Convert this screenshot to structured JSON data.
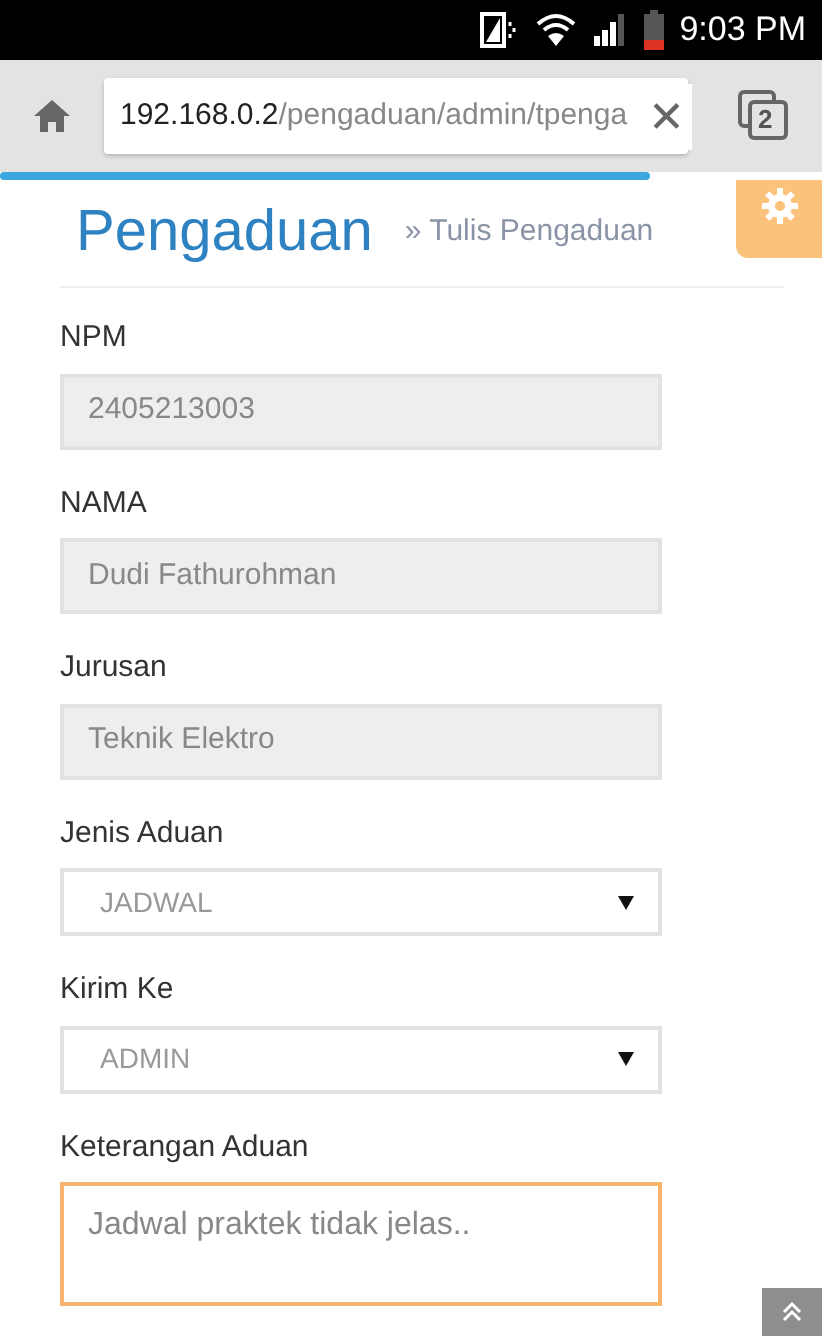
{
  "status_bar": {
    "time": "9:03 PM"
  },
  "browser": {
    "url_host": "192.168.0.2",
    "url_path": "/pengaduan/admin/tpenga",
    "clear": "✕",
    "tab_count": "2",
    "loading": {
      "level": 0.79
    }
  },
  "header": {
    "title": "Pengaduan",
    "breadcrumb": "» Tulis Pengaduan"
  },
  "form": {
    "fields": [
      {
        "kind": "readonly",
        "label": "NPM",
        "value": "2405213003",
        "focused": false
      },
      {
        "kind": "readonly",
        "label": "NAMA",
        "value": "Dudi Fathurohman",
        "focused": false
      },
      {
        "kind": "readonly",
        "label": "Jurusan",
        "value": "Teknik Elektro",
        "focused": false
      },
      {
        "kind": "select",
        "label": "Jenis Aduan",
        "value": "JADWAL",
        "focused": false
      },
      {
        "kind": "select",
        "label": "Kirim Ke",
        "value": "ADMIN",
        "focused": false
      },
      {
        "kind": "textarea",
        "label": "Keterangan Aduan",
        "value": "Jadwal praktek tidak jelas..",
        "focused": true
      }
    ]
  }
}
